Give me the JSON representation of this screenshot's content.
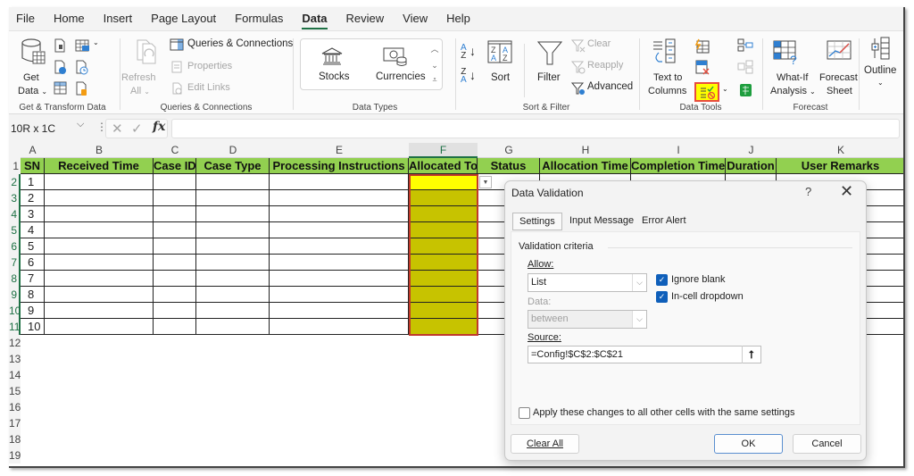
{
  "menu": {
    "tabs": [
      "File",
      "Home",
      "Insert",
      "Page Layout",
      "Formulas",
      "Data",
      "Review",
      "View",
      "Help"
    ],
    "active": "Data"
  },
  "ribbon": {
    "get_transform": {
      "get_data_line1": "Get",
      "get_data_line2": "Data",
      "label": "Get & Transform Data"
    },
    "queries": {
      "refresh_line1": "Refresh",
      "refresh_line2": "All",
      "queries_connections": "Queries & Connections",
      "properties": "Properties",
      "edit_links": "Edit Links",
      "label": "Queries & Connections"
    },
    "data_types": {
      "stocks": "Stocks",
      "currencies": "Currencies",
      "label": "Data Types"
    },
    "sort_filter": {
      "sort": "Sort",
      "filter": "Filter",
      "clear": "Clear",
      "reapply": "Reapply",
      "advanced": "Advanced",
      "label": "Sort & Filter"
    },
    "data_tools": {
      "text_to_line1": "Text to",
      "text_to_line2": "Columns",
      "label": "Data Tools"
    },
    "forecast": {
      "whatif_line1": "What-If",
      "whatif_line2": "Analysis",
      "forecast_line1": "Forecast",
      "forecast_line2": "Sheet",
      "label": "Forecast"
    },
    "outline": {
      "label": "Outline"
    }
  },
  "formula_bar": {
    "name_box": "10R x 1C",
    "fx": "fx",
    "formula": ""
  },
  "sheet": {
    "columns": [
      "A",
      "B",
      "C",
      "D",
      "E",
      "F",
      "G",
      "H",
      "I",
      "J",
      "K"
    ],
    "selected_column": "F",
    "headers": [
      "SN",
      "Received Time",
      "Case ID",
      "Case Type",
      "Processing Instructions",
      "Allocated To",
      "Status",
      "Allocation Time",
      "Completion Time",
      "Duration",
      "User Remarks"
    ],
    "row_numbers": [
      "1",
      "2",
      "3",
      "4",
      "5",
      "6",
      "7",
      "8",
      "9",
      "10",
      "11",
      "12",
      "13",
      "14",
      "15",
      "16",
      "17",
      "18",
      "19"
    ],
    "sn_values": [
      "1",
      "2",
      "3",
      "4",
      "5",
      "6",
      "7",
      "8",
      "9",
      "10"
    ],
    "colors": {
      "header_fill": "#92d050",
      "active_cell": "#ffff00",
      "selected_range": "#c7c300"
    }
  },
  "dialog": {
    "title": "Data Validation",
    "help": "?",
    "close": "✕",
    "tabs": [
      "Settings",
      "Input Message",
      "Error Alert"
    ],
    "active_tab": "Settings",
    "section": "Validation criteria",
    "allow_label": "Allow:",
    "allow_value": "List",
    "ignore_blank": {
      "label": "Ignore blank",
      "checked": true
    },
    "in_cell_dropdown": {
      "label": "In-cell dropdown",
      "checked": true
    },
    "data_label": "Data:",
    "data_value": "between",
    "source_label": "Source:",
    "source_value": "=Config!$C$2:$C$21",
    "apply_all": {
      "label": "Apply these changes to all other cells with the same settings",
      "checked": false
    },
    "buttons": {
      "clear_all": "Clear All",
      "ok": "OK",
      "cancel": "Cancel"
    }
  }
}
